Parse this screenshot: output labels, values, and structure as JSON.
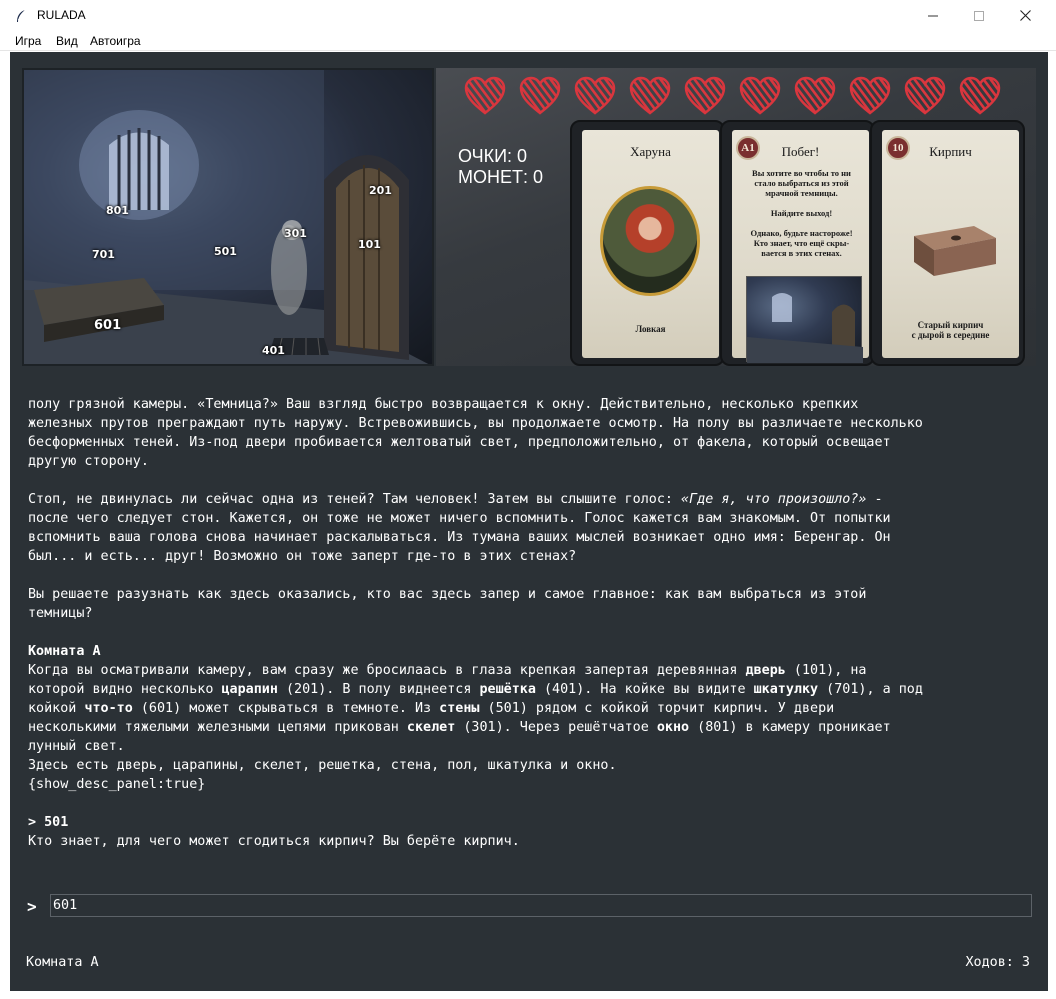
{
  "window": {
    "title": "RULADA",
    "minimize": "—",
    "maximize": "☐",
    "close": "✕"
  },
  "menu": {
    "items": [
      "Игра",
      "Вид",
      "Автоигра"
    ]
  },
  "scene": {
    "labels": [
      "801",
      "701",
      "501",
      "301",
      "201",
      "101",
      "601",
      "401"
    ]
  },
  "hud": {
    "hearts_count": 10,
    "heart_color": "#d9363e",
    "score_line": "ОЧКИ: 0",
    "coins_line": "МОНЕТ: 0"
  },
  "cards": [
    {
      "title": "Харуна",
      "badge": "",
      "caption": "Ловкая"
    },
    {
      "title": "Побег!",
      "badge": "A1",
      "body_lines": [
        "Вы хотите во чтобы то ни",
        "стало выбраться из этой",
        "мрачной темницы.",
        "",
        "Найдите выход!",
        "",
        "Однако, будьте настороже!",
        "Кто знает, что ещё скры-",
        "вается в этих стенах."
      ]
    },
    {
      "title": "Кирпич",
      "badge": "10",
      "caption_lines": [
        "Старый кирпич",
        "с дырой в середине"
      ]
    }
  ],
  "story": {
    "p1": [
      "полу грязной камеры. «Темница?» Ваш взгляд быстро возвращается к окну. Действительно, несколько крепких",
      "железных прутов преграждают путь наружу. Встревожившись, вы продолжаете осмотр. На полу вы различаете несколько",
      "бесформенных теней. Из-под двери пробивается желтоватый свет, предположительно, от факела, который освещает",
      "другую сторону."
    ],
    "p2_a": "Стоп, не двинулась ли сейчас одна из теней? Там человек! Затем вы слышите голос: ",
    "p2_italic": "«Где я, что произошло?»",
    "p2_b": " -",
    "p2_rest": [
      "после чего следует стон. Кажется, он тоже не может ничего вспомнить. Голос кажется вам знакомым. От попытки",
      "вспомнить ваша голова снова начинает раскалываться. Из тумана ваших мыслей возникает одно имя: Беренгар. Он",
      "был... и есть... друг! Возможно он тоже заперт где-то в этих стенах?"
    ],
    "p3": [
      "Вы решаете разузнать как здесь оказались, кто вас здесь запер и самое главное: как вам выбраться из этой",
      "темницы?"
    ],
    "room_heading": "Комната А",
    "room": {
      "l1_a": "Когда вы осматривали камеру, вам сразу же бросилаась в глаза крепкая запертая деревянная ",
      "l1_b": "дверь",
      "l1_c": " (101), на",
      "l2_a": "которой видно несколько ",
      "l2_b": "царапин",
      "l2_c": " (201). В полу виднеется ",
      "l2_d": "решётка",
      "l2_e": " (401). На койке вы видите ",
      "l2_f": "шкатулку",
      "l2_g": " (701), а под",
      "l3_a": "койкой ",
      "l3_b": "что-то",
      "l3_c": " (601) может скрываться в темноте. Из ",
      "l3_d": "стены",
      "l3_e": " (501) рядом с койкой торчит кирпич. У двери",
      "l4_a": "несколькими тяжелыми железными цепями прикован ",
      "l4_b": "скелет",
      "l4_c": " (301). Через решётчатое ",
      "l4_d": "окно",
      "l4_e": " (801) в камеру проникает",
      "l5": "лунный свет.",
      "l6": "Здесь есть дверь, царапины, скелет, решетка, стена, пол, шкатулка и окно.",
      "l7": "{show_desc_panel:true}"
    },
    "cmd_echo": "> 501",
    "cmd_result": "Кто знает, для чего может сгодиться кирпич? Вы берёте кирпич."
  },
  "input": {
    "prompt": ">",
    "value": "601"
  },
  "status": {
    "room": "Комната А",
    "moves": "Ходов: 3"
  }
}
